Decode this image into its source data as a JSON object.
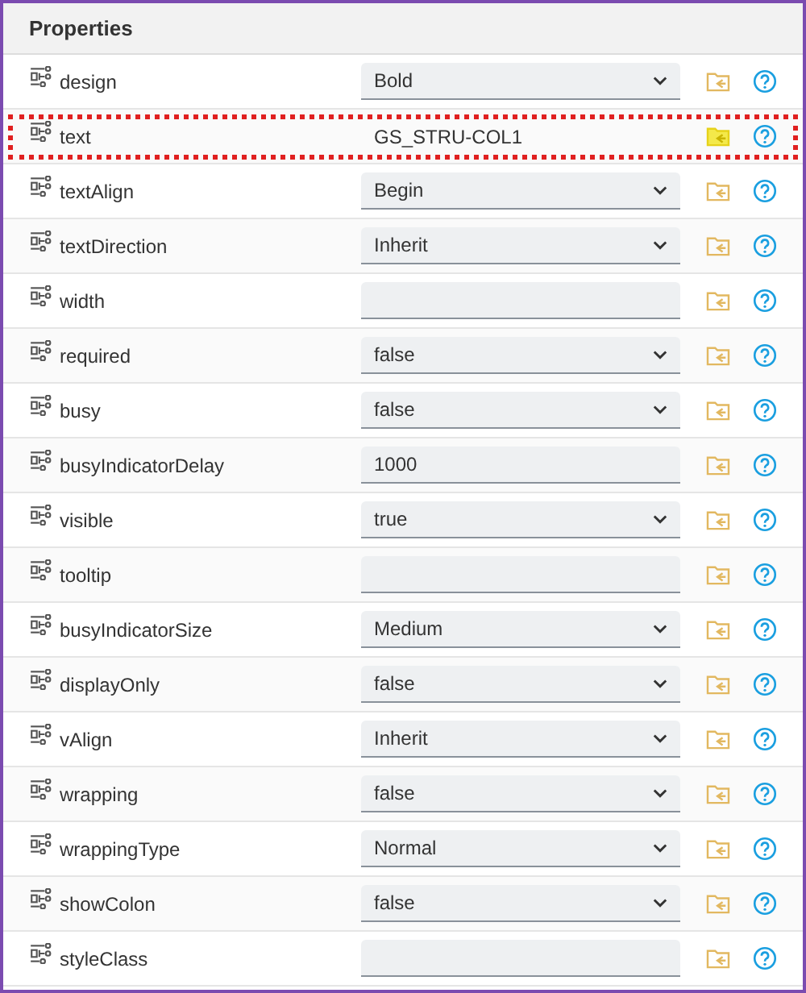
{
  "panel": {
    "title": "Properties"
  },
  "properties": [
    {
      "name": "design",
      "kind": "select",
      "value": "Bold",
      "highlighted": false
    },
    {
      "name": "text",
      "kind": "bound",
      "value": "GS_STRU-COL1",
      "highlighted": true
    },
    {
      "name": "textAlign",
      "kind": "select",
      "value": "Begin",
      "highlighted": false
    },
    {
      "name": "textDirection",
      "kind": "select",
      "value": "Inherit",
      "highlighted": false
    },
    {
      "name": "width",
      "kind": "input",
      "highlighted": false
    },
    {
      "name": "required",
      "kind": "select",
      "value": "false",
      "highlighted": false
    },
    {
      "name": "busy",
      "kind": "select",
      "value": "false",
      "highlighted": false
    },
    {
      "name": "busyIndicatorDelay",
      "kind": "input",
      "value": "1000",
      "highlighted": false
    },
    {
      "name": "visible",
      "kind": "select",
      "value": "true",
      "highlighted": false
    },
    {
      "name": "tooltip",
      "kind": "input",
      "highlighted": false
    },
    {
      "name": "busyIndicatorSize",
      "kind": "select",
      "value": "Medium",
      "highlighted": false
    },
    {
      "name": "displayOnly",
      "kind": "select",
      "value": "false",
      "highlighted": false
    },
    {
      "name": "vAlign",
      "kind": "select",
      "value": "Inherit",
      "highlighted": false
    },
    {
      "name": "wrapping",
      "kind": "select",
      "value": "false",
      "highlighted": false
    },
    {
      "name": "wrappingType",
      "kind": "select",
      "value": "Normal",
      "highlighted": false
    },
    {
      "name": "showColon",
      "kind": "select",
      "value": "false",
      "highlighted": false
    },
    {
      "name": "styleClass",
      "kind": "input",
      "highlighted": false
    }
  ]
}
